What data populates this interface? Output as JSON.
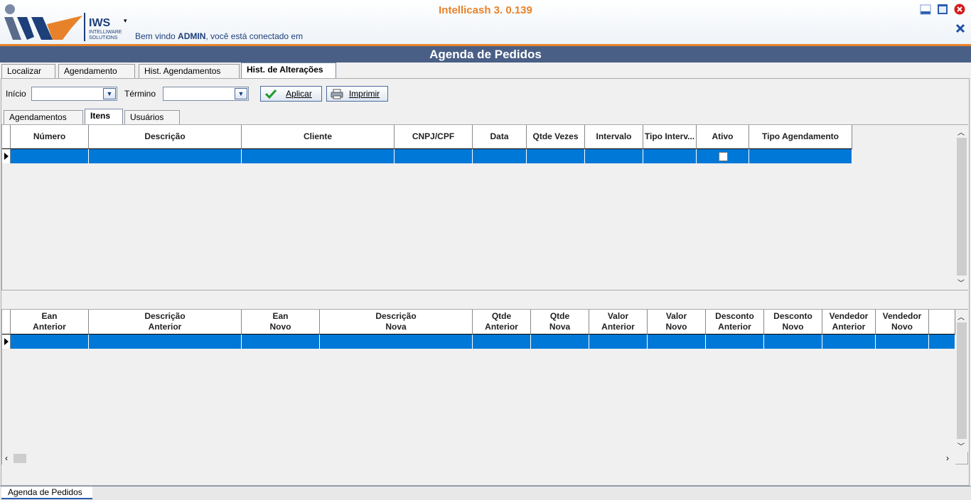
{
  "app": {
    "title": "Intellicash 3. 0.139",
    "logo_text": "IWS",
    "logo_sub": "INTELLIWARE SOLUTIONS"
  },
  "welcome": {
    "prefix": "Bem vindo ",
    "user": "ADMIN",
    "suffix": ", você está conectado em"
  },
  "window_title": "Agenda de Pedidos",
  "main_tabs": [
    {
      "label": "Localizar",
      "active": false
    },
    {
      "label": "Agendamento",
      "active": false
    },
    {
      "label": "Hist. Agendamentos",
      "active": false
    },
    {
      "label": "Hist. de Alterações",
      "active": true
    }
  ],
  "filters": {
    "start_label": "Início",
    "start_value": "",
    "end_label": "Término",
    "end_value": "",
    "apply_label": "Aplicar",
    "print_label": "Imprimir"
  },
  "sub_tabs": [
    {
      "label": "Agendamentos",
      "active": false
    },
    {
      "label": "Itens",
      "active": true
    },
    {
      "label": "Usuários",
      "active": false
    }
  ],
  "grid1": {
    "columns": [
      "Número",
      "Descrição",
      "Cliente",
      "CNPJ/CPF",
      "Data",
      "Qtde Vezes",
      "Intervalo",
      "Tipo Interv...",
      "Ativo",
      "Tipo Agendamento"
    ],
    "rows": [
      {
        "ativo": false
      }
    ]
  },
  "grid2": {
    "columns": [
      [
        "Ean",
        "Anterior"
      ],
      [
        "Descrição",
        "Anterior"
      ],
      [
        "Ean",
        "Novo"
      ],
      [
        "Descrição",
        "Nova"
      ],
      [
        "Qtde",
        "Anterior"
      ],
      [
        "Qtde",
        "Nova"
      ],
      [
        "Valor",
        "Anterior"
      ],
      [
        "Valor",
        "Novo"
      ],
      [
        "Desconto",
        "Anterior"
      ],
      [
        "Desconto",
        "Novo"
      ],
      [
        "Vendedor",
        "Anterior"
      ],
      [
        "Vendedor",
        "Novo"
      ]
    ],
    "rows": [
      {}
    ]
  },
  "bottom_tab": "Agenda de Pedidos",
  "colors": {
    "accent": "#e8822a",
    "titlebar": "#4a5f86",
    "selection": "#0078d7"
  }
}
